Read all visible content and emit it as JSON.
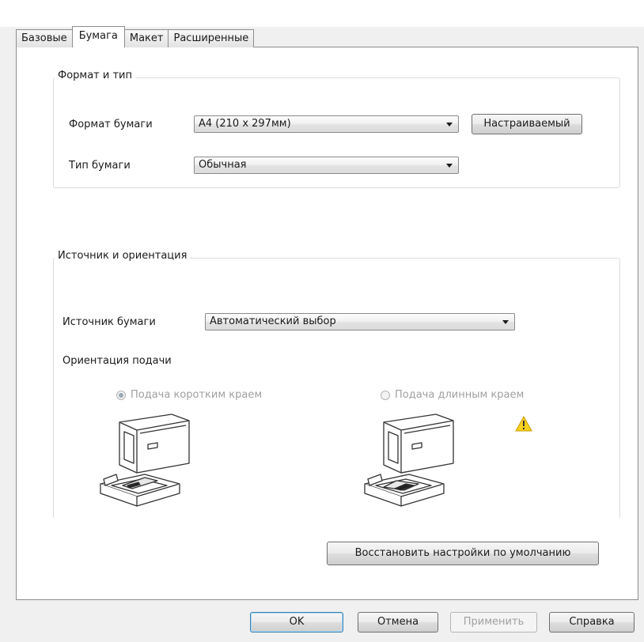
{
  "tabs": [
    "Базовые",
    "Бумага",
    "Макет",
    "Расширенные"
  ],
  "format_group": {
    "title": "Формат и тип",
    "paper_size_label": "Формат бумаги",
    "paper_size_value": "A4 (210 x 297мм)",
    "custom_button": "Настраиваемый",
    "paper_type_label": "Тип бумаги",
    "paper_type_value": "Обычная"
  },
  "source_group": {
    "title": "Источник и ориентация",
    "source_label": "Источник бумаги",
    "source_value": "Автоматический выбор",
    "orientation_label": "Ориентация подачи",
    "short_edge": "Подача коротким краем",
    "long_edge": "Подача длинным краем"
  },
  "restore_button": "Восстановить настройки по умолчанию",
  "footer": {
    "ok": "OK",
    "cancel": "Отмена",
    "apply": "Применить",
    "help": "Справка"
  }
}
